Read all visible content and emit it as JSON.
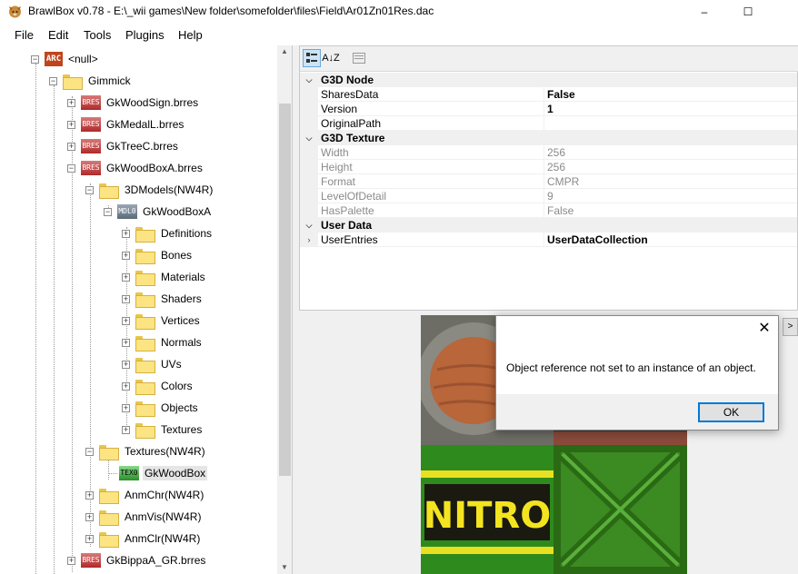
{
  "window": {
    "title": "BrawlBox v0.78 - E:\\_wii games\\New folder\\somefolder\\files\\Field\\Ar01Zn01Res.dac",
    "icon": "brawlbox-fox-icon",
    "minimize_label": "–",
    "maximize_label": "☐"
  },
  "menu": {
    "items": [
      "File",
      "Edit",
      "Tools",
      "Plugins",
      "Help"
    ]
  },
  "tree": {
    "root": {
      "badge": "ARC",
      "label": "<null>"
    },
    "gimmick": {
      "label": "Gimmick"
    },
    "brres1": {
      "badge": "BRES",
      "label": "GkWoodSign.brres"
    },
    "brres2": {
      "badge": "BRES",
      "label": "GkMedalL.brres"
    },
    "brres3": {
      "badge": "BRES",
      "label": "GkTreeC.brres"
    },
    "brres4": {
      "badge": "BRES",
      "label": "GkWoodBoxA.brres"
    },
    "models_folder": {
      "label": "3DModels(NW4R)"
    },
    "model": {
      "badge": "MDL0",
      "label": "GkWoodBoxA"
    },
    "model_children": [
      "Definitions",
      "Bones",
      "Materials",
      "Shaders",
      "Vertices",
      "Normals",
      "UVs",
      "Colors",
      "Objects",
      "Textures"
    ],
    "textures_folder": {
      "label": "Textures(NW4R)"
    },
    "texture": {
      "badge": "TEX0",
      "label": "GkWoodBox"
    },
    "anm_folders": [
      "AnmChr(NW4R)",
      "AnmVis(NW4R)",
      "AnmClr(NW4R)"
    ],
    "brres5": {
      "badge": "BRES",
      "label": "GkBippaA_GR.brres"
    },
    "expand_glyph": "+",
    "collapse_glyph": "−"
  },
  "toolbar": {
    "categorized_icon": "categorized-icon",
    "alphabetical_label": "A↓Z",
    "property_pages_icon": "property-pages-icon"
  },
  "properties": {
    "categories": [
      {
        "label": "G3D Node"
      },
      {
        "label": "G3D Texture"
      },
      {
        "label": "User Data"
      }
    ],
    "g3d_node": [
      {
        "name": "SharesData",
        "value": "False"
      },
      {
        "name": "Version",
        "value": "1"
      },
      {
        "name": "OriginalPath",
        "value": ""
      }
    ],
    "g3d_texture": [
      {
        "name": "Width",
        "value": "256"
      },
      {
        "name": "Height",
        "value": "256"
      },
      {
        "name": "Format",
        "value": "CMPR"
      },
      {
        "name": "LevelOfDetail",
        "value": "9"
      },
      {
        "name": "HasPalette",
        "value": "False"
      }
    ],
    "user_data": [
      {
        "name": "UserEntries",
        "value": "UserDataCollection"
      }
    ]
  },
  "preview": {
    "texture_text": "NITRO"
  },
  "side_nav_label": ">",
  "dialog": {
    "message": "Object reference not set to an instance of an object.",
    "ok_label": "OK",
    "close_label": "✕"
  }
}
